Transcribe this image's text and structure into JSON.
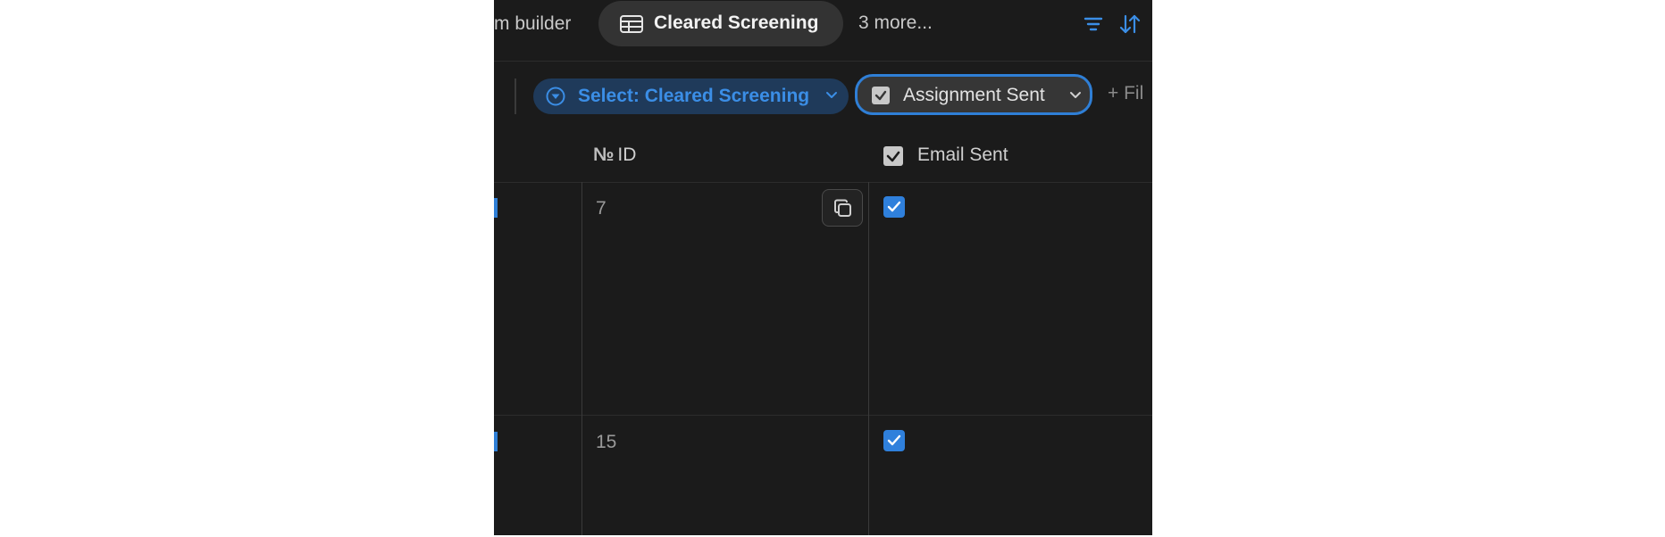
{
  "tabs": {
    "partial_label": "m builder",
    "active_label": "Cleared Screening",
    "more_label": "3 more..."
  },
  "filters": {
    "select_chip_label": "Select: Cleared Screening",
    "checkbox_chip_label": "Assignment Sent",
    "add_filter_label": "+ Fil"
  },
  "table": {
    "columns": [
      {
        "icon": "number-sign-icon",
        "glyph": "№",
        "label": "ID"
      },
      {
        "icon": "checkbox-icon",
        "label": "Email Sent"
      }
    ],
    "rows": [
      {
        "id": "7",
        "email_sent": true
      },
      {
        "id": "15",
        "email_sent": true
      }
    ]
  },
  "colors": {
    "accent": "#2f80dc",
    "background": "#1b1b1b",
    "chip_select_bg": "#1f3a5a"
  },
  "icons": [
    "table-icon",
    "filter-icon",
    "sort-icon",
    "filter-circle-icon",
    "chevron-down-icon",
    "checkbox-icon",
    "copy-icon",
    "checkmark-icon"
  ]
}
